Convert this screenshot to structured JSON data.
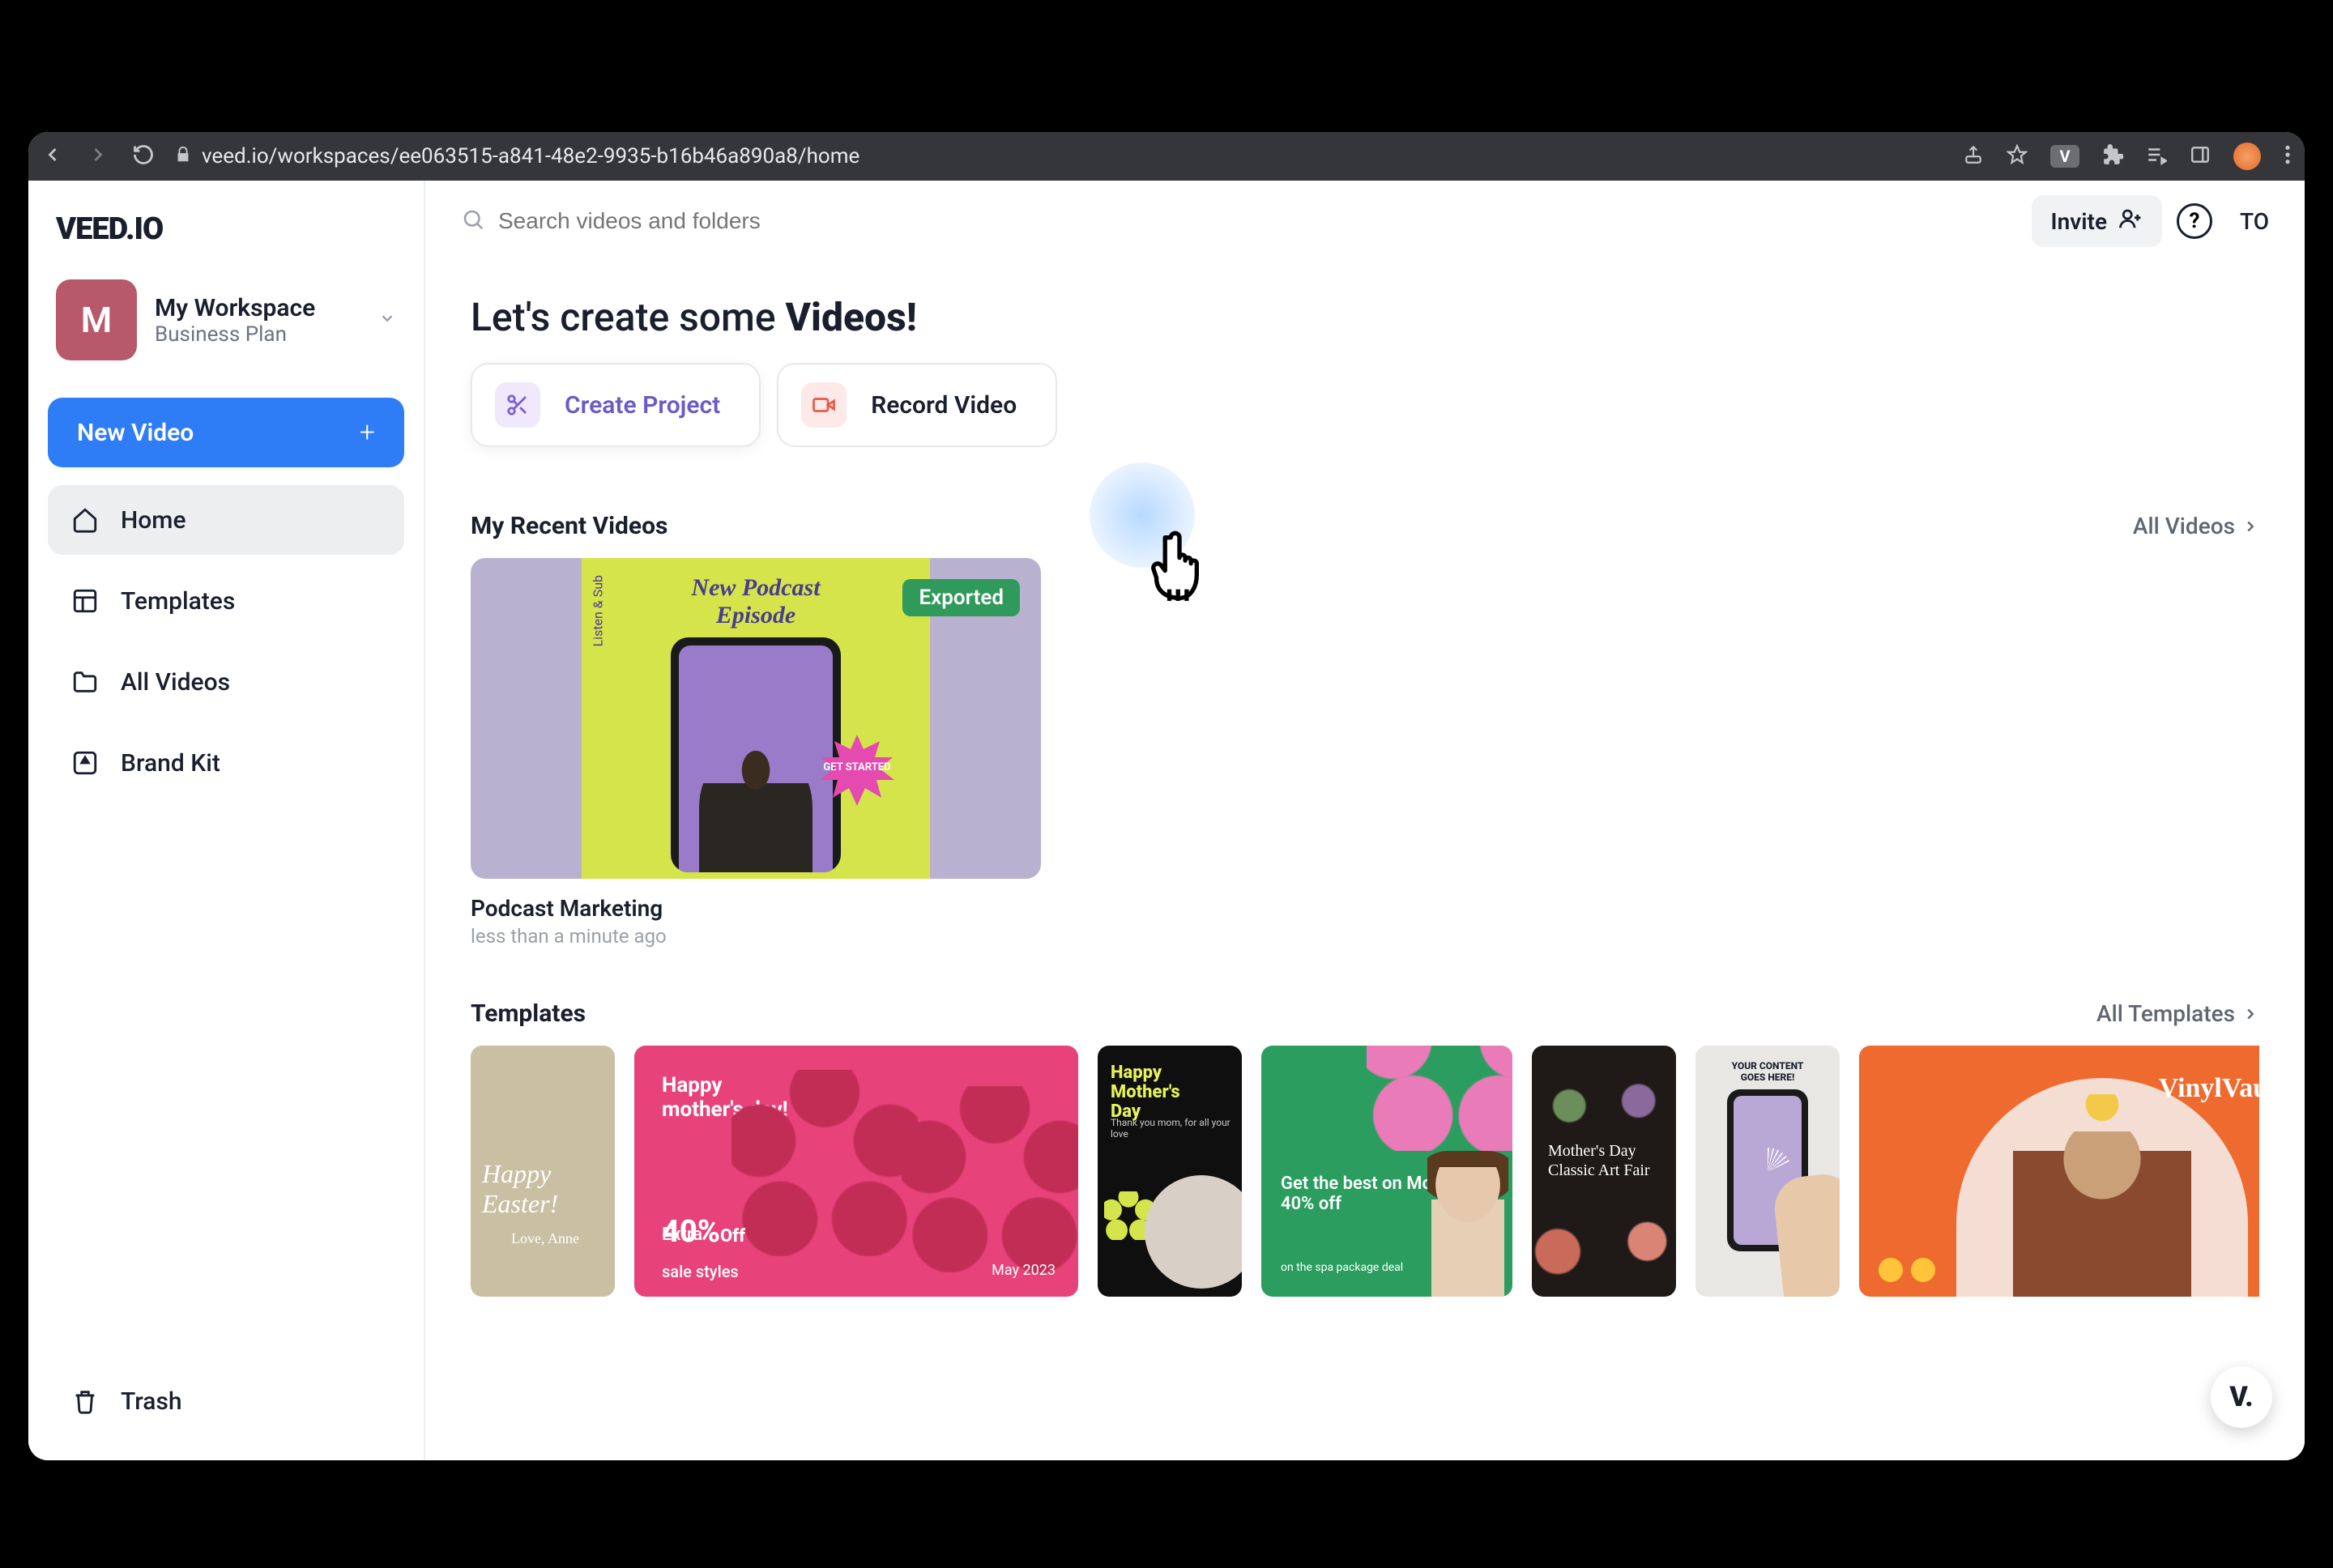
{
  "browser": {
    "url": "veed.io/workspaces/ee063515-a841-48e2-9935-b16b46a890a8/home",
    "ext_badge": "V"
  },
  "app": {
    "logo": "VEED.IO",
    "workspace": {
      "initial": "M",
      "name": "My Workspace",
      "plan": "Business Plan"
    },
    "sidebar": {
      "new_video": "New Video",
      "items": [
        {
          "label": "Home"
        },
        {
          "label": "Templates"
        },
        {
          "label": "All Videos"
        },
        {
          "label": "Brand Kit"
        }
      ],
      "trash": "Trash"
    },
    "topbar": {
      "search_placeholder": "Search videos and folders",
      "invite": "Invite",
      "user_initials": "TO"
    },
    "hero": {
      "prefix": "Let's create some ",
      "bold": "Videos!"
    },
    "actions": {
      "create": "Create Project",
      "record": "Record Video"
    },
    "recent": {
      "title": "My Recent Videos",
      "link": "All Videos",
      "videos": [
        {
          "name": "Podcast Marketing",
          "time": "less than a minute ago",
          "badge": "Exported",
          "thumb_title": "New Podcast",
          "thumb_sub": "Episode",
          "curved": "Listen & Sub",
          "cta": "GET STARTED"
        }
      ]
    },
    "templates": {
      "title": "Templates",
      "link": "All Templates",
      "items": [
        {
          "line1": "Happy",
          "line2": "Easter!",
          "sig": "Love, Anne"
        },
        {
          "line1": "Happy",
          "line2": "mother's day!",
          "extra": "Extra",
          "pct": "40%",
          "off": "Off",
          "sub": "sale styles",
          "date": "May 2023"
        },
        {
          "line1": "Happy",
          "line2": "Mother's",
          "line3": "Day",
          "sub": "Thank you mom, for all your love"
        },
        {
          "line1": "Get the best on Mother's day",
          "line2": "40% off",
          "sub": "on the spa package deal"
        },
        {
          "line1": "Mother's Day",
          "line2": "Classic Art Fair"
        },
        {
          "cap": "YOUR CONTENT GOES HERE!"
        },
        {
          "brand": "VinylVault"
        }
      ]
    },
    "help_badge": "V."
  }
}
